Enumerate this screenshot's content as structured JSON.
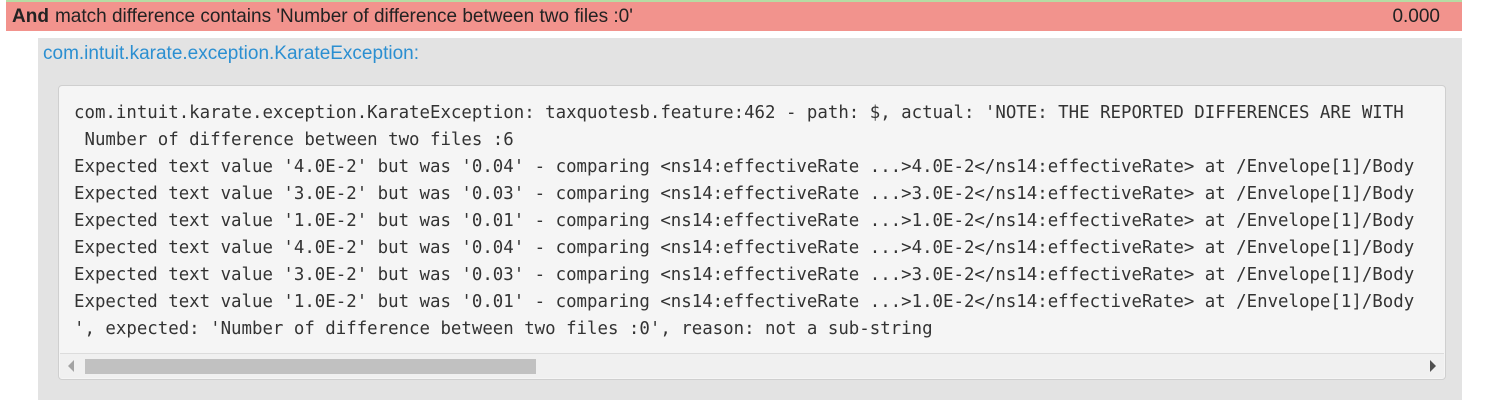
{
  "step": {
    "keyword": "And",
    "text": "match difference contains 'Number of difference between two files :0'",
    "duration": "0.000",
    "status_color": "#f2938d"
  },
  "error": {
    "exception_class": "com.intuit.karate.exception.KarateException:",
    "lines": [
      "com.intuit.karate.exception.KarateException: taxquotesb.feature:462 - path: $, actual: 'NOTE: THE REPORTED DIFFERENCES ARE WITH",
      " Number of difference between two files :6",
      "Expected text value '4.0E-2' but was '0.04' - comparing <ns14:effectiveRate ...>4.0E-2</ns14:effectiveRate> at /Envelope[1]/Body",
      "Expected text value '3.0E-2' but was '0.03' - comparing <ns14:effectiveRate ...>3.0E-2</ns14:effectiveRate> at /Envelope[1]/Body",
      "Expected text value '1.0E-2' but was '0.01' - comparing <ns14:effectiveRate ...>1.0E-2</ns14:effectiveRate> at /Envelope[1]/Body",
      "Expected text value '4.0E-2' but was '0.04' - comparing <ns14:effectiveRate ...>4.0E-2</ns14:effectiveRate> at /Envelope[1]/Body",
      "Expected text value '3.0E-2' but was '0.03' - comparing <ns14:effectiveRate ...>3.0E-2</ns14:effectiveRate> at /Envelope[1]/Body",
      "Expected text value '1.0E-2' but was '0.01' - comparing <ns14:effectiveRate ...>1.0E-2</ns14:effectiveRate> at /Envelope[1]/Body",
      "', expected: 'Number of difference between two files :0', reason: not a sub-string"
    ]
  },
  "scrollbar": {
    "left_icon": "scroll-left-arrow-icon",
    "right_icon": "scroll-right-arrow-icon"
  }
}
